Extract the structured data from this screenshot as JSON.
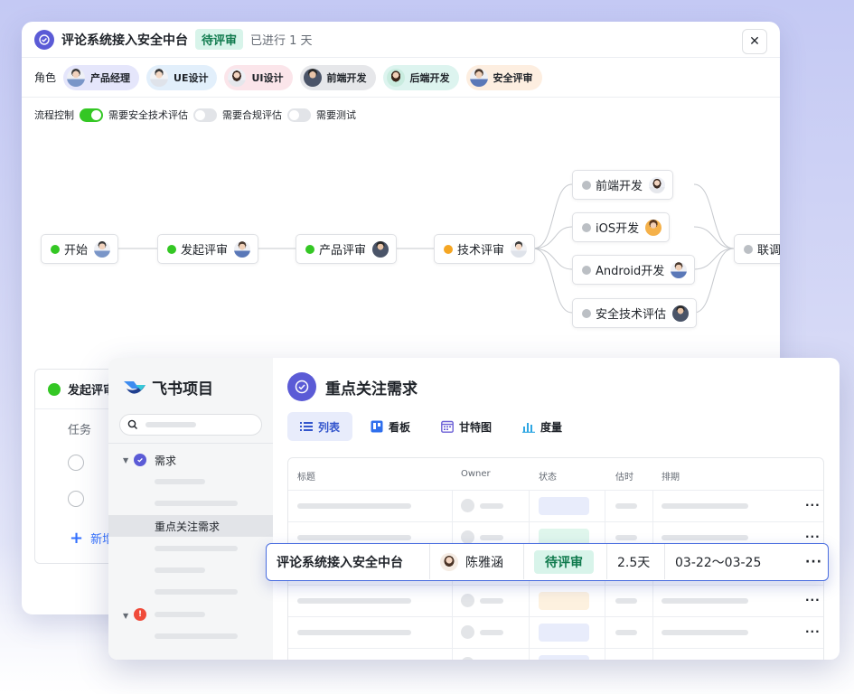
{
  "back_window": {
    "title": "评论系统接入安全中台",
    "status": "待评审",
    "progress": "已进行 1 天",
    "close_icon": "close-icon",
    "roles_label": "角色",
    "roles": [
      {
        "label": "产品经理",
        "bg": "#e5e6fb"
      },
      {
        "label": "UE设计",
        "bg": "#e2effb"
      },
      {
        "label": "UI设计",
        "bg": "#fbe5ea"
      },
      {
        "label": "前端开发",
        "bg": "#e6e7ea"
      },
      {
        "label": "后端开发",
        "bg": "#ddf4ef"
      },
      {
        "label": "安全评审",
        "bg": "#fdeee0"
      }
    ],
    "toggles": [
      {
        "label": "流程控制",
        "on": true
      },
      {
        "label": "需要安全技术评估",
        "on": false
      },
      {
        "label": "需要合规评估",
        "on": false
      },
      {
        "label": "需要测试",
        "on": false
      }
    ],
    "flow_nodes": [
      {
        "label": "开始",
        "status": "done"
      },
      {
        "label": "发起评审",
        "status": "done"
      },
      {
        "label": "产品评审",
        "status": "done"
      },
      {
        "label": "技术评审",
        "status": "in-progress"
      },
      {
        "label": "前端开发",
        "status": "pending"
      },
      {
        "label": "iOS开发",
        "status": "pending"
      },
      {
        "label": "Android开发",
        "status": "pending"
      },
      {
        "label": "安全技术评估",
        "status": "pending"
      },
      {
        "label": "联调",
        "status": "pending"
      }
    ],
    "task_panel": {
      "title": "发起评审",
      "column": "任务",
      "add_label": "新增"
    }
  },
  "front_window": {
    "brand": "飞书项目",
    "sidebar": {
      "tree_root": "需求",
      "selected": "重点关注需求"
    },
    "page_title": "重点关注需求",
    "tabs": [
      {
        "label": "列表",
        "icon": "list-icon",
        "active": true
      },
      {
        "label": "看板",
        "icon": "kanban-icon",
        "active": false
      },
      {
        "label": "甘特图",
        "icon": "gantt-icon",
        "active": false
      },
      {
        "label": "度量",
        "icon": "chart-icon",
        "active": false
      }
    ],
    "table": {
      "headers": [
        "标题",
        "Owner",
        "状态",
        "估时",
        "排期"
      ],
      "highlight_row": {
        "title": "评论系统接入安全中台",
        "owner": "陈雅涵",
        "status": "待评审",
        "estimate": "2.5天",
        "schedule": "03-22～03-25",
        "more_icon": "more-icon"
      }
    }
  },
  "colors": {
    "accent": "#5b5bd6",
    "done": "#34c724",
    "in_progress": "#f5a623",
    "pending": "#bbbfc4",
    "tag_bg": "#d8f4ea",
    "tag_text": "#0f7a4d"
  }
}
